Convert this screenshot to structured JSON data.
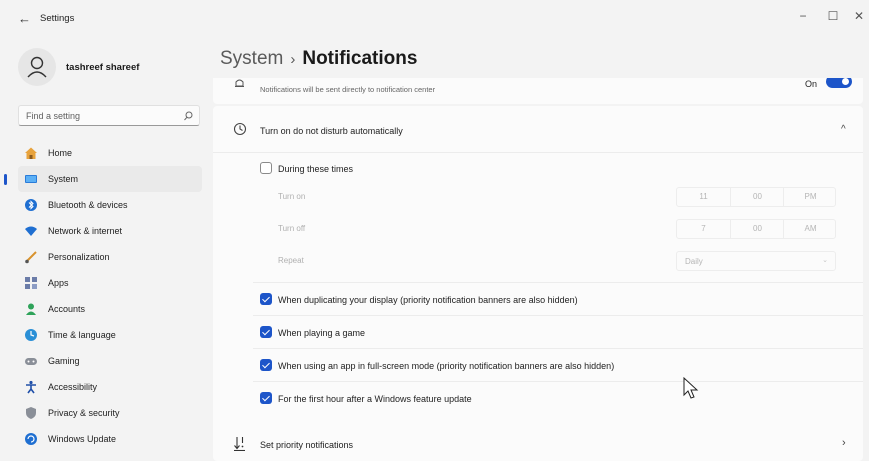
{
  "window": {
    "title": "Settings",
    "controls": {
      "minimize": "−",
      "maximize": "☐",
      "close": "✕"
    }
  },
  "user": {
    "name": "tashreef shareef"
  },
  "search": {
    "placeholder": "Find a setting"
  },
  "sidebar": {
    "items": [
      {
        "label": "Home",
        "icon": "home-icon"
      },
      {
        "label": "System",
        "icon": "system-icon",
        "active": true
      },
      {
        "label": "Bluetooth & devices",
        "icon": "bluetooth-icon"
      },
      {
        "label": "Network & internet",
        "icon": "wifi-icon"
      },
      {
        "label": "Personalization",
        "icon": "brush-icon"
      },
      {
        "label": "Apps",
        "icon": "apps-icon"
      },
      {
        "label": "Accounts",
        "icon": "person-icon"
      },
      {
        "label": "Time & language",
        "icon": "globe-clock-icon"
      },
      {
        "label": "Gaming",
        "icon": "gamepad-icon"
      },
      {
        "label": "Accessibility",
        "icon": "accessibility-icon"
      },
      {
        "label": "Privacy & security",
        "icon": "shield-icon"
      },
      {
        "label": "Windows Update",
        "icon": "update-icon"
      }
    ]
  },
  "breadcrumb": {
    "parent": "System",
    "separator": "›",
    "current": "Notifications"
  },
  "dnd": {
    "description": "Notifications will be sent directly to notification center",
    "toggle_state": "On"
  },
  "auto_dnd": {
    "title": "Turn on do not disturb automatically",
    "during_times": {
      "label": "During these times",
      "checked": false
    },
    "turn_on": {
      "label": "Turn on",
      "hour": "11",
      "minute": "00",
      "period": "PM"
    },
    "turn_off": {
      "label": "Turn off",
      "hour": "7",
      "minute": "00",
      "period": "AM"
    },
    "repeat": {
      "label": "Repeat",
      "value": "Daily"
    },
    "options": [
      {
        "label": "When duplicating your display (priority notification banners are also hidden)",
        "checked": true
      },
      {
        "label": "When playing a game",
        "checked": true
      },
      {
        "label": "When using an app in full-screen mode (priority notification banners are also hidden)",
        "checked": true
      },
      {
        "label": "For the first hour after a Windows feature update",
        "checked": true
      }
    ]
  },
  "priority": {
    "label": "Set priority notifications"
  },
  "colors": {
    "accent": "#1d55c9",
    "background": "#f3f3f3",
    "card": "#fbfbfb"
  }
}
